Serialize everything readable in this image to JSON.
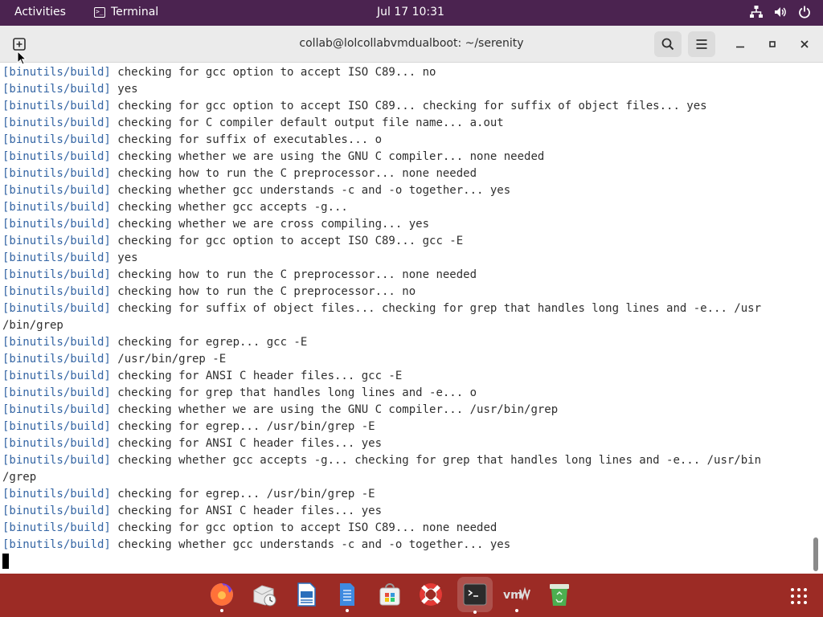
{
  "topbar": {
    "activities": "Activities",
    "app_name": "Terminal",
    "clock": "Jul 17  10:31",
    "tray_icons": [
      "network-icon",
      "volume-icon",
      "power-icon"
    ]
  },
  "window": {
    "title": "collab@lolcollabvmdualboot: ~/serenity"
  },
  "terminal": {
    "tag": "[binutils/build]",
    "lines": [
      {
        "tag": "[binutils/build]",
        "text": " checking for gcc option to accept ISO C89... no"
      },
      {
        "tag": "[binutils/build]",
        "text": " yes"
      },
      {
        "tag": "[binutils/build]",
        "text": " checking for gcc option to accept ISO C89... checking for suffix of object files... yes"
      },
      {
        "tag": "[binutils/build]",
        "text": " checking for C compiler default output file name... a.out"
      },
      {
        "tag": "[binutils/build]",
        "text": " checking for suffix of executables... o"
      },
      {
        "tag": "[binutils/build]",
        "text": " checking whether we are using the GNU C compiler... none needed"
      },
      {
        "tag": "[binutils/build]",
        "text": " checking how to run the C preprocessor... none needed"
      },
      {
        "tag": "[binutils/build]",
        "text": " checking whether gcc understands -c and -o together... yes"
      },
      {
        "tag": "[binutils/build]",
        "text": " checking whether gcc accepts -g..."
      },
      {
        "tag": "[binutils/build]",
        "text": " checking whether we are cross compiling... yes"
      },
      {
        "tag": "[binutils/build]",
        "text": " checking for gcc option to accept ISO C89... gcc -E"
      },
      {
        "tag": "[binutils/build]",
        "text": " yes"
      },
      {
        "tag": "[binutils/build]",
        "text": " checking how to run the C preprocessor... none needed"
      },
      {
        "tag": "[binutils/build]",
        "text": " checking how to run the C preprocessor... no"
      },
      {
        "tag": "[binutils/build]",
        "text": " checking for suffix of object files... checking for grep that handles long lines and -e... /usr"
      },
      {
        "tag": "",
        "text": "/bin/grep"
      },
      {
        "tag": "[binutils/build]",
        "text": " checking for egrep... gcc -E"
      },
      {
        "tag": "[binutils/build]",
        "text": " /usr/bin/grep -E"
      },
      {
        "tag": "[binutils/build]",
        "text": " checking for ANSI C header files... gcc -E"
      },
      {
        "tag": "[binutils/build]",
        "text": " checking for grep that handles long lines and -e... o"
      },
      {
        "tag": "[binutils/build]",
        "text": " checking whether we are using the GNU C compiler... /usr/bin/grep"
      },
      {
        "tag": "[binutils/build]",
        "text": " checking for egrep... /usr/bin/grep -E"
      },
      {
        "tag": "[binutils/build]",
        "text": " checking for ANSI C header files... yes"
      },
      {
        "tag": "[binutils/build]",
        "text": " checking whether gcc accepts -g... checking for grep that handles long lines and -e... /usr/bin"
      },
      {
        "tag": "",
        "text": "/grep"
      },
      {
        "tag": "[binutils/build]",
        "text": " checking for egrep... /usr/bin/grep -E"
      },
      {
        "tag": "[binutils/build]",
        "text": " checking for ANSI C header files... yes"
      },
      {
        "tag": "[binutils/build]",
        "text": " checking for gcc option to accept ISO C89... none needed"
      },
      {
        "tag": "[binutils/build]",
        "text": " checking whether gcc understands -c and -o together... yes"
      }
    ]
  },
  "dock": {
    "items": [
      {
        "name": "firefox-icon",
        "running": true
      },
      {
        "name": "evolution-icon",
        "running": false
      },
      {
        "name": "libreoffice-writer-icon",
        "running": false
      },
      {
        "name": "files-icon",
        "running": true
      },
      {
        "name": "software-icon",
        "running": false
      },
      {
        "name": "help-icon",
        "running": false
      },
      {
        "name": "terminal-icon",
        "running": true
      },
      {
        "name": "vmware-icon",
        "running": true
      },
      {
        "name": "trash-icon",
        "running": false
      }
    ]
  },
  "colors": {
    "topbar": "#4b2350",
    "dock": "#9c2b25",
    "prompt_tag": "#3465a4"
  }
}
